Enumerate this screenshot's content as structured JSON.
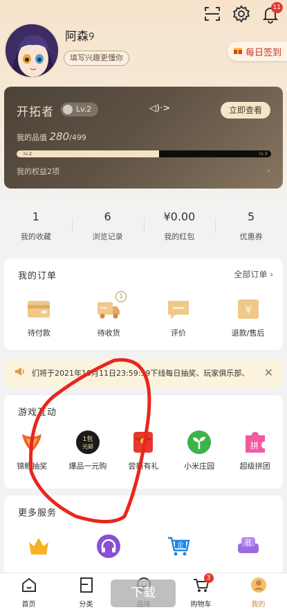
{
  "header": {
    "username": "阿森୨",
    "tag_button": "填写兴趣更懂你",
    "notification_count": "11",
    "signin_label": "每日签到"
  },
  "vip": {
    "title": "开拓者",
    "level": "Lv.2",
    "sound_label": "◁)·>",
    "check_button": "立即查看",
    "points_label": "我的品值",
    "points_value": "280",
    "points_total": "/499",
    "progress": 0.56,
    "level_left": "lv.2",
    "level_right": "lv.3",
    "rights_label": "我的权益2项"
  },
  "stats": [
    {
      "num": "1",
      "label": "我的收藏"
    },
    {
      "num": "6",
      "label": "浏览记录"
    },
    {
      "num": "¥0.00",
      "label": "我的红包"
    },
    {
      "num": "5",
      "label": "优惠券"
    }
  ],
  "orders": {
    "title": "我的订单",
    "more": "全部订单",
    "items": [
      {
        "label": "待付款",
        "icon": "wallet-icon"
      },
      {
        "label": "待收货",
        "icon": "truck-icon",
        "badge": "1"
      },
      {
        "label": "评价",
        "icon": "comment-icon"
      },
      {
        "label": "退款/售后",
        "icon": "refund-icon"
      }
    ]
  },
  "notice": {
    "text": "们将于2021年10月11日23:59:59下线每日抽奖、玩家俱乐部、"
  },
  "games": {
    "title": "游戏互动",
    "items": [
      {
        "label": "锦鲤抽奖",
        "icon": "koi-icon"
      },
      {
        "label": "爆品一元购",
        "icon": "one-yuan-icon"
      },
      {
        "label": "尝新有礼",
        "icon": "red-envelope-icon"
      },
      {
        "label": "小米庄园",
        "icon": "sprout-icon"
      },
      {
        "label": "超级拼团",
        "icon": "puzzle-icon"
      }
    ]
  },
  "services": {
    "title": "更多服务",
    "items": [
      {
        "icon": "crown-icon"
      },
      {
        "icon": "headphones-icon"
      },
      {
        "icon": "enterprise-cart-icon"
      },
      {
        "icon": "station-sofa-icon"
      }
    ]
  },
  "bottom_nav": [
    {
      "label": "首页",
      "icon": "home-icon"
    },
    {
      "label": "分类",
      "icon": "category-icon"
    },
    {
      "label": "品味",
      "icon": "taste-icon"
    },
    {
      "label": "购物车",
      "icon": "cart-icon",
      "badge": "3"
    },
    {
      "label": "我的",
      "icon": "profile-icon"
    }
  ],
  "overlay": {
    "download": "下载"
  },
  "colors": {
    "accent": "#c5894a",
    "red": "#e23a2e",
    "card_dark": "#4c4238"
  }
}
